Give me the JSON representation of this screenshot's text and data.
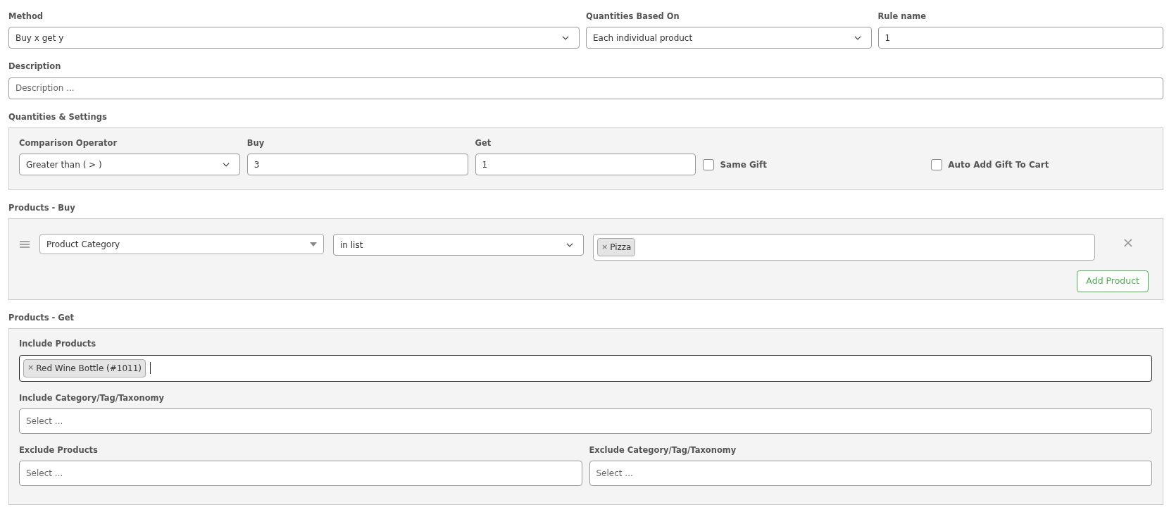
{
  "method": {
    "label": "Method",
    "value": "Buy x get y"
  },
  "quantities_based_on": {
    "label": "Quantities Based On",
    "value": "Each individual product"
  },
  "rule_name": {
    "label": "Rule name",
    "value": "1"
  },
  "description": {
    "label": "Description",
    "placeholder": "Description ..."
  },
  "quantities_settings": {
    "title": "Quantities & Settings",
    "comparison_operator": {
      "label": "Comparison Operator",
      "value": "Greater than ( > )"
    },
    "buy": {
      "label": "Buy",
      "value": "3"
    },
    "get": {
      "label": "Get",
      "value": "1"
    },
    "checkboxes": [
      {
        "label": "Same Gift",
        "checked": false
      },
      {
        "label": "Auto Add Gift To Cart",
        "checked": false
      }
    ]
  },
  "products_buy": {
    "title": "Products - Buy",
    "rows": [
      {
        "type": "Product Category",
        "operator": "in list",
        "tags": [
          {
            "remove": "×",
            "label": "Pizza"
          }
        ],
        "remove": "×"
      }
    ],
    "add_button": "Add Product"
  },
  "products_get": {
    "title": "Products - Get",
    "include_products": {
      "label": "Include Products",
      "focused": true,
      "tags": [
        {
          "remove": "×",
          "label": "Red Wine Bottle (#1011)"
        }
      ]
    },
    "include_category": {
      "label": "Include Category/Tag/Taxonomy",
      "placeholder": "Select ..."
    },
    "exclude_products": {
      "label": "Exclude Products",
      "placeholder": "Select ..."
    },
    "exclude_category": {
      "label": "Exclude Category/Tag/Taxonomy",
      "placeholder": "Select ..."
    }
  }
}
